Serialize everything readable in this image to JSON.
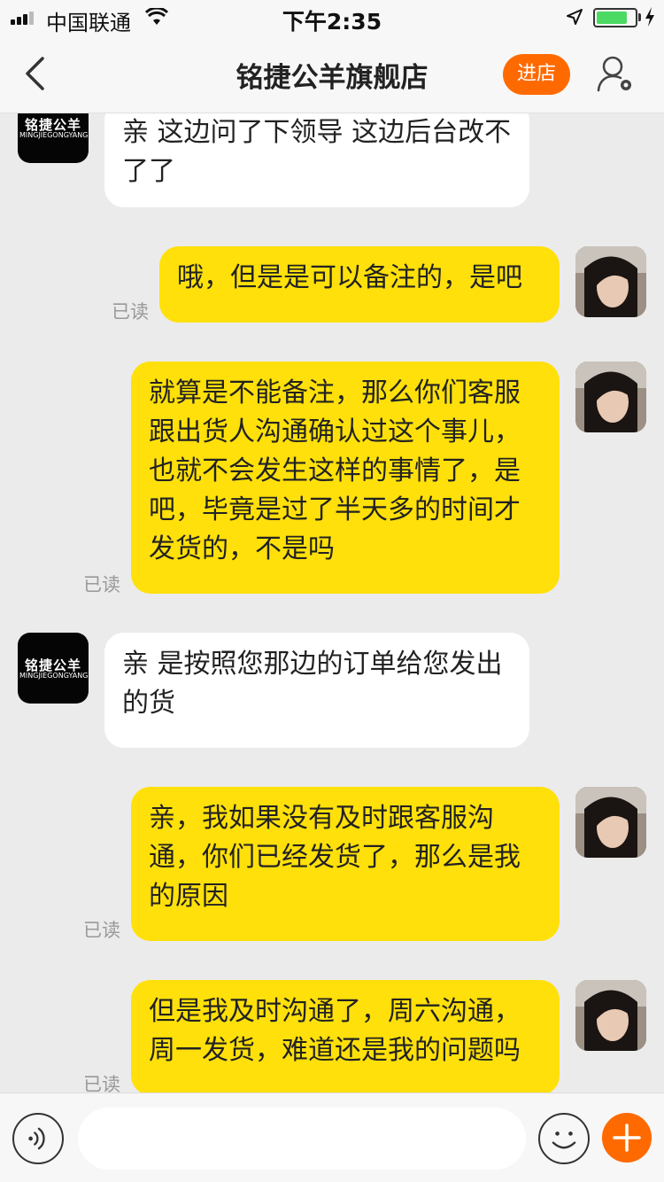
{
  "status_bar": {
    "carrier": "中国联通",
    "time": "下午2:35",
    "battery_level": 0.8
  },
  "header": {
    "title": "铭捷公羊旗舰店",
    "enter_store_label": "进店"
  },
  "store_avatar": {
    "logo_cn": "铭捷公羊",
    "logo_en": "MINGJIEGONGYANG"
  },
  "messages": [
    {
      "sender": "store",
      "text": "亲  这边问了下领导 这边后台改不了了"
    },
    {
      "sender": "user",
      "text": "哦，但是是可以备注的，是吧",
      "status": "已读"
    },
    {
      "sender": "user",
      "text": "就算是不能备注，那么你们客服跟出货人沟通确认过这个事儿，也就不会发生这样的事情了，是吧，毕竟是过了半天多的时间才发货的，不是吗",
      "status": "已读"
    },
    {
      "sender": "store",
      "text": "亲   是按照您那边的订单给您发出的货"
    },
    {
      "sender": "user",
      "text": "亲，我如果没有及时跟客服沟通，你们已经发货了，那么是我的原因",
      "status": "已读"
    },
    {
      "sender": "user",
      "text": "但是我及时沟通了，周六沟通，周一发货，难道还是我的问题吗",
      "status": "已读"
    }
  ],
  "input_bar": {
    "text_value": ""
  },
  "colors": {
    "accent": "#ff6a00",
    "user_bubble": "#ffe00a",
    "store_bubble": "#ffffff",
    "background": "#ebebeb"
  }
}
